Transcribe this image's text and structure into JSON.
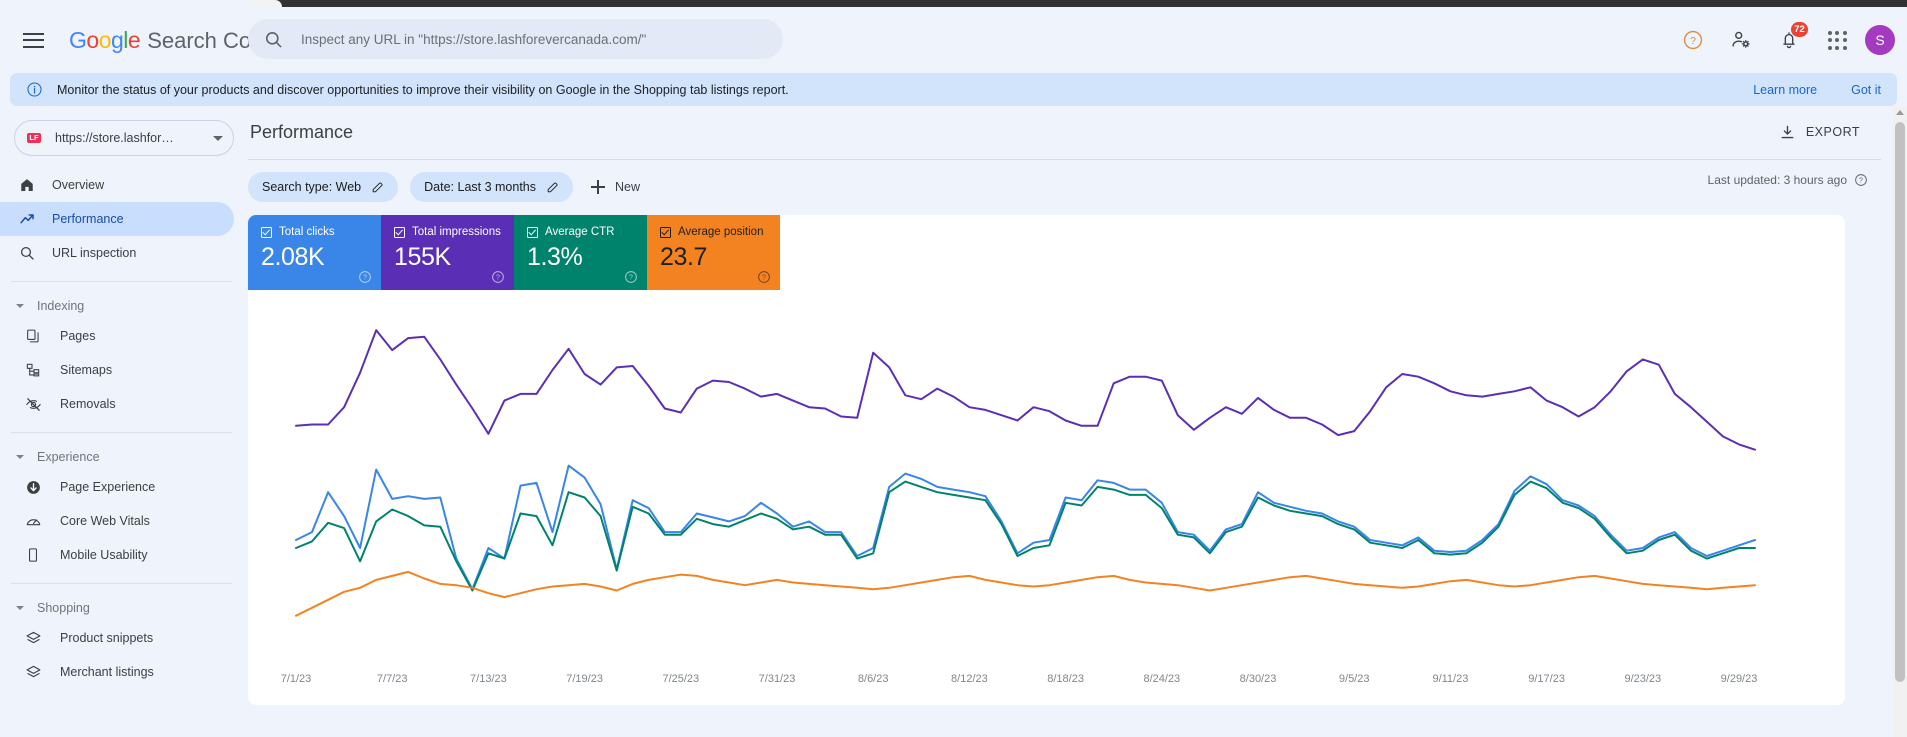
{
  "appbar": {
    "menu_icon": "hamburger-menu-icon",
    "brand_google": "Google",
    "brand_product": "Search Console",
    "search_placeholder": "Inspect any URL in \"https://store.lashforevercanada.com/\"",
    "search_value": "",
    "help_icon": "help-circle-icon",
    "account_settings_icon": "person-gear-icon",
    "notifications_icon": "bell-icon",
    "notifications_count": "72",
    "apps_icon": "apps-grid-icon",
    "avatar_initial": "S"
  },
  "banner": {
    "info_icon": "info-circle-icon",
    "message": "Monitor the status of your products and discover opportunities to improve their visibility on Google in the Shopping tab listings report.",
    "learn_more": "Learn more",
    "got_it": "Got it"
  },
  "sidebar": {
    "property": {
      "logo_text": "LF",
      "label": "https://store.lashfor…",
      "caret_icon": "chevron-down-icon"
    },
    "items": [
      {
        "label": "Overview",
        "icon": "home-icon",
        "active": false
      },
      {
        "label": "Performance",
        "icon": "trending-up-icon",
        "active": true
      },
      {
        "label": "URL inspection",
        "icon": "search-icon",
        "active": false
      }
    ],
    "groups": [
      {
        "label": "Indexing",
        "caret_icon": "caret-down-icon",
        "items": [
          {
            "label": "Pages",
            "icon": "pages-icon"
          },
          {
            "label": "Sitemaps",
            "icon": "sitemap-icon"
          },
          {
            "label": "Removals",
            "icon": "eye-off-icon"
          }
        ]
      },
      {
        "label": "Experience",
        "caret_icon": "caret-down-icon",
        "items": [
          {
            "label": "Page Experience",
            "icon": "page-experience-icon"
          },
          {
            "label": "Core Web Vitals",
            "icon": "gauge-icon"
          },
          {
            "label": "Mobile Usability",
            "icon": "mobile-icon"
          }
        ]
      },
      {
        "label": "Shopping",
        "caret_icon": "caret-down-icon",
        "items": [
          {
            "label": "Product snippets",
            "icon": "layers-icon"
          },
          {
            "label": "Merchant listings",
            "icon": "layers-icon"
          }
        ]
      }
    ]
  },
  "page": {
    "title": "Performance",
    "export_label": "EXPORT",
    "export_icon": "download-icon",
    "last_updated": "Last updated: 3 hours ago",
    "last_updated_help_icon": "help-circle-icon"
  },
  "filters": {
    "chips": [
      {
        "label": "Search type: Web",
        "edit_icon": "pencil-icon"
      },
      {
        "label": "Date: Last 3 months",
        "edit_icon": "pencil-icon"
      }
    ],
    "new_label": "New",
    "new_icon": "plus-icon"
  },
  "metrics": [
    {
      "key": "clicks",
      "name": "Total clicks",
      "value": "2.08K",
      "color": "#3a85e8",
      "checked": true,
      "help_icon": "help-circle-icon"
    },
    {
      "key": "impressions",
      "name": "Total impressions",
      "value": "155K",
      "color": "#5a2fb5",
      "checked": true,
      "help_icon": "help-circle-icon"
    },
    {
      "key": "ctr",
      "name": "Average CTR",
      "value": "1.3%",
      "color": "#00836d",
      "checked": true,
      "help_icon": "help-circle-icon"
    },
    {
      "key": "position",
      "name": "Average position",
      "value": "23.7",
      "color": "#f38321",
      "checked": true,
      "help_icon": "help-circle-icon"
    }
  ],
  "chart_data": {
    "type": "line",
    "title": "",
    "xlabel": "",
    "ylabel": "",
    "grid": false,
    "legend": "metric-tiles-above-chart",
    "x_tick_labels": [
      "7/1/23",
      "7/7/23",
      "7/13/23",
      "7/19/23",
      "7/25/23",
      "7/31/23",
      "8/6/23",
      "8/12/23",
      "8/18/23",
      "8/24/23",
      "8/30/23",
      "9/5/23",
      "9/11/23",
      "9/17/23",
      "9/23/23",
      "9/29/23"
    ],
    "x_tick_indices": [
      0,
      6,
      12,
      18,
      24,
      30,
      36,
      42,
      48,
      54,
      60,
      66,
      72,
      78,
      84,
      90
    ],
    "x_count": 92,
    "series": [
      {
        "name": "Total impressions",
        "color": "#5a2fb5",
        "values": [
          1560,
          1570,
          1570,
          1700,
          1960,
          2280,
          2130,
          2220,
          2230,
          2060,
          1870,
          1690,
          1500,
          1750,
          1800,
          1800,
          1980,
          2140,
          1950,
          1870,
          2000,
          2010,
          1860,
          1690,
          1660,
          1840,
          1900,
          1890,
          1840,
          1780,
          1800,
          1750,
          1700,
          1690,
          1630,
          1620,
          2110,
          2000,
          1790,
          1760,
          1840,
          1780,
          1700,
          1680,
          1640,
          1600,
          1700,
          1670,
          1600,
          1560,
          1560,
          1880,
          1930,
          1930,
          1900,
          1640,
          1530,
          1620,
          1700,
          1650,
          1770,
          1680,
          1620,
          1620,
          1570,
          1490,
          1520,
          1670,
          1850,
          1950,
          1930,
          1880,
          1820,
          1790,
          1780,
          1800,
          1820,
          1850,
          1750,
          1700,
          1630,
          1700,
          1820,
          1970,
          2060,
          2020,
          1800,
          1700,
          1590,
          1480,
          1420,
          1380
        ]
      },
      {
        "name": "Total clicks",
        "color": "#3a85e8",
        "values": [
          700,
          760,
          1060,
          880,
          640,
          1230,
          1010,
          1030,
          1010,
          1020,
          560,
          330,
          640,
          560,
          1110,
          1130,
          760,
          1260,
          1170,
          970,
          480,
          1000,
          940,
          760,
          760,
          900,
          870,
          840,
          880,
          980,
          900,
          800,
          840,
          760,
          760,
          580,
          640,
          1100,
          1200,
          1160,
          1100,
          1080,
          1060,
          1030,
          840,
          600,
          680,
          700,
          1020,
          1000,
          1150,
          1130,
          1080,
          1080,
          980,
          760,
          740,
          620,
          780,
          820,
          1060,
          980,
          950,
          920,
          900,
          840,
          800,
          700,
          680,
          660,
          720,
          620,
          610,
          620,
          700,
          820,
          1070,
          1180,
          1120,
          1000,
          960,
          880,
          740,
          620,
          640,
          720,
          760,
          640,
          580,
          620,
          660
        ]
      },
      {
        "name": "Average CTR",
        "color": "#00836d",
        "values": [
          640,
          690,
          830,
          790,
          540,
          840,
          930,
          880,
          810,
          800,
          540,
          320,
          600,
          560,
          900,
          880,
          660,
          1060,
          1020,
          880,
          470,
          950,
          900,
          740,
          740,
          860,
          820,
          800,
          850,
          900,
          860,
          780,
          800,
          740,
          740,
          560,
          600,
          1060,
          1140,
          1100,
          1060,
          1040,
          1020,
          1000,
          820,
          580,
          640,
          660,
          980,
          960,
          1100,
          1080,
          1040,
          1040,
          940,
          740,
          720,
          600,
          760,
          800,
          1020,
          960,
          920,
          900,
          880,
          820,
          780,
          680,
          660,
          640,
          700,
          600,
          590,
          600,
          680,
          800,
          1040,
          1140,
          1090,
          980,
          940,
          860,
          720,
          600,
          620,
          700,
          740,
          620,
          560,
          600,
          640
        ]
      },
      {
        "name": "Average position",
        "color": "#f38321",
        "values": [
          130,
          190,
          250,
          310,
          340,
          400,
          430,
          460,
          410,
          370,
          360,
          340,
          300,
          270,
          300,
          330,
          350,
          360,
          370,
          350,
          320,
          370,
          400,
          420,
          440,
          430,
          400,
          380,
          360,
          380,
          400,
          380,
          370,
          360,
          350,
          340,
          330,
          340,
          360,
          380,
          400,
          420,
          430,
          400,
          380,
          360,
          350,
          360,
          380,
          400,
          420,
          430,
          400,
          380,
          370,
          360,
          340,
          320,
          340,
          360,
          380,
          400,
          420,
          430,
          410,
          390,
          370,
          360,
          350,
          340,
          350,
          370,
          390,
          400,
          380,
          360,
          350,
          360,
          380,
          400,
          420,
          430,
          410,
          390,
          370,
          360,
          350,
          340,
          330,
          340,
          350,
          360
        ]
      }
    ]
  }
}
